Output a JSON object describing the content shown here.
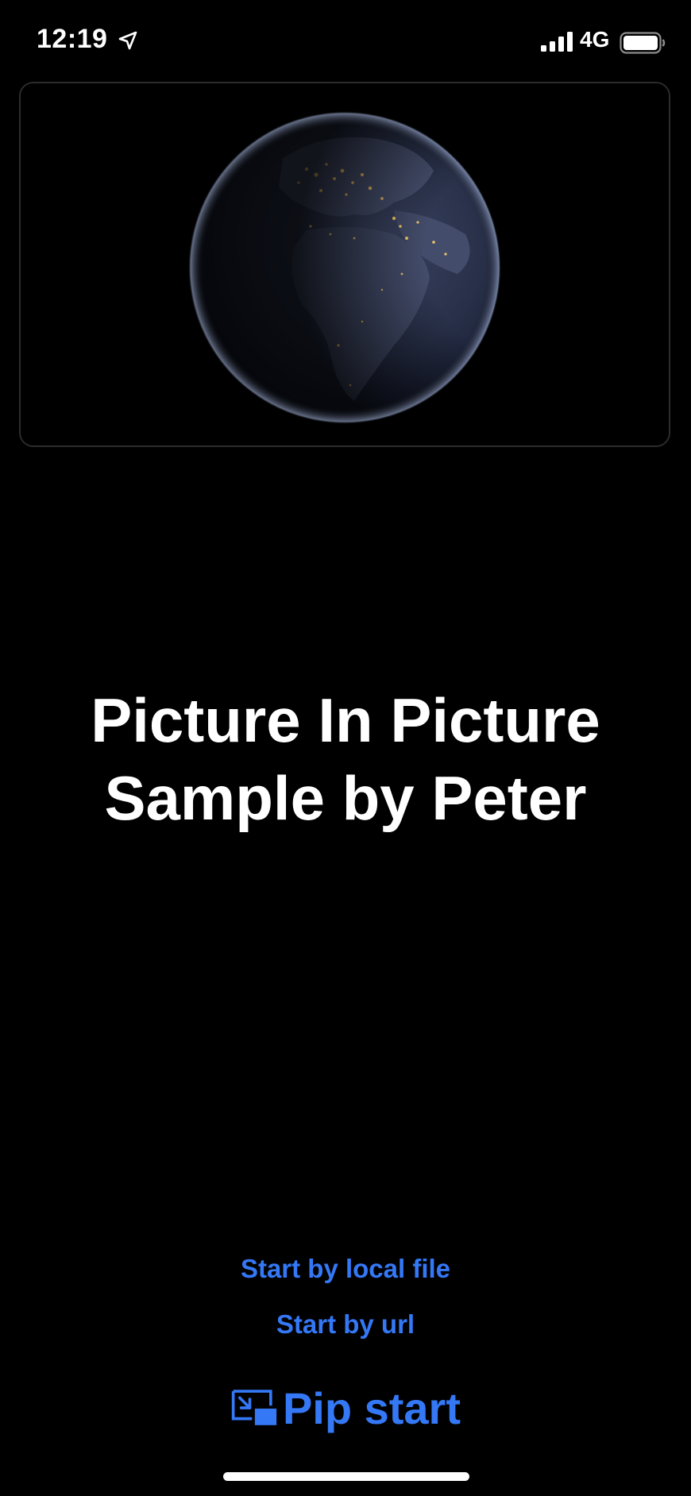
{
  "status_bar": {
    "time": "12:19",
    "network": "4G",
    "location_icon": "location-arrow-icon",
    "signal_icon": "signal-bars-icon",
    "battery_icon": "battery-full-icon"
  },
  "video": {
    "content": "earth-globe-night"
  },
  "title": {
    "line1": "Picture In Picture",
    "line2": "Sample by Peter"
  },
  "buttons": {
    "local_file": "Start by local file",
    "url": "Start by url",
    "pip_start": "Pip start",
    "pip_icon": "pip-enter-icon"
  },
  "colors": {
    "background": "#000000",
    "accent": "#3478f6",
    "text": "#ffffff"
  }
}
